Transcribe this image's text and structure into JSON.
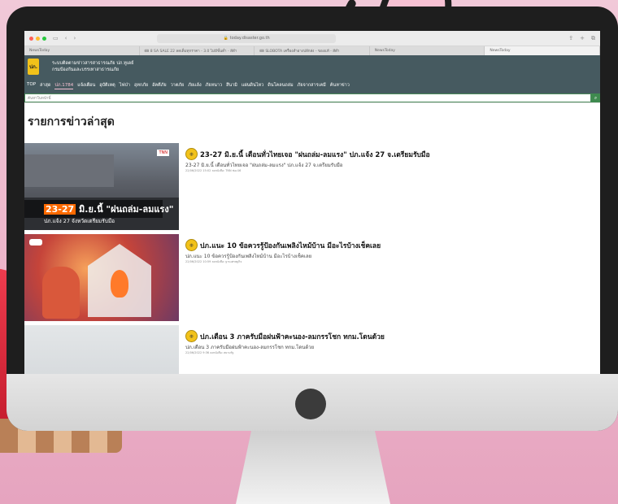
{
  "browser": {
    "url": "today.disaster.go.th",
    "tabs": [
      {
        "label": "NewsToday",
        "active": false
      },
      {
        "label": "🎟 8 SA SALE 22 ลดเต็มทุกราคา - 3.0 ไม่มีขั้นต่ำ - สีดำ",
        "active": false
      },
      {
        "label": "🎟 SLOBOTA เครื่องสำอางปลีกส่ง - ของแท้ - สีดำ",
        "active": false
      },
      {
        "label": "NewsToday",
        "active": false
      },
      {
        "label": "NewsToday",
        "active": true
      }
    ]
  },
  "site": {
    "logo_text": "ปภ.",
    "title_line1": "ระบบติดตามข่าวสารสาธารณภัย ปภ.ทูเดย์",
    "title_line2": "กรมป้องกันและบรรเทาสาธารณภัย",
    "nav": [
      {
        "label": "TOP",
        "active": false
      },
      {
        "label": "ล่าสุด",
        "active": false
      },
      {
        "label": "ปภ.1784",
        "active": true
      },
      {
        "label": "แจ้งเตือน",
        "active": false
      },
      {
        "label": "อุบัติเหตุ",
        "active": false
      },
      {
        "label": "ไฟป่า",
        "active": false
      },
      {
        "label": "อุทกภัย",
        "active": false
      },
      {
        "label": "อัคคีภัย",
        "active": false
      },
      {
        "label": "วาตภัย",
        "active": false
      },
      {
        "label": "ภัยแล้ง",
        "active": false
      },
      {
        "label": "ภัยหนาว",
        "active": false
      },
      {
        "label": "สึนามิ",
        "active": false
      },
      {
        "label": "แผ่นดินไหว",
        "active": false
      },
      {
        "label": "ดินโคลนถล่ม",
        "active": false
      },
      {
        "label": "ภัยจากสารเคมี",
        "active": false
      },
      {
        "label": "ค้นหาข่าว",
        "active": false
      }
    ],
    "search_placeholder": "ค้นหาในหน้านี้",
    "search_icon": "magnifier"
  },
  "main": {
    "section_title": "รายการข่าวล่าสุด",
    "news": [
      {
        "title": "23-27 มิ.ย.นี้ เตือนทั่วไทยเจอ \"ฝนถล่ม-ลมแรง\" ปภ.แจ้ง 27 จ.เตรียมรับมือ",
        "desc": "23-27 มิ.ย.นี้ เตือนทั่วไทยเจอ \"ฝนถล่ม-ลมแรง\" ปภ.แจ้ง 27 จ.เตรียมรับมือ",
        "meta": "22/06/2022 15:02  ลงหนังสือ: TNN ช่อง16",
        "thumb_headline_num": "23-27",
        "thumb_headline_text": " มิ.ย.นี้ \"ฝนถล่ม-ลมแรง\"",
        "thumb_sub": "ปภ.แจ้ง 27 จังหวัดเตรียมรับมือ",
        "thumb_brand": "TNN"
      },
      {
        "title": "ปภ.แนะ 10 ข้อควรรู้ป้องกันเพลิงไหม้บ้าน มีอะไรบ้างเช็คเลย",
        "desc": "ปภ.แนะ 10 ข้อควรรู้ป้องกันเพลิงไหม้บ้าน มีอะไรบ้างเช็คเลย",
        "meta": "22/06/2022 10:59  ลงหนังสือ: ฐานเศรษฐกิจ"
      },
      {
        "title": "ปภ.เตือน 3 ภาครับมือฝนฟ้าคะนอง-ลมกรรโชก ทกม.โดนด้วย",
        "desc": "ปภ.เตือน 3 ภาครับมือฝนฟ้าคะนอง-ลมกรรโชก ทกม.โดนด้วย",
        "meta": "22/06/2022 9:36  ลงหนังสือ: สยามรัฐ"
      }
    ]
  }
}
